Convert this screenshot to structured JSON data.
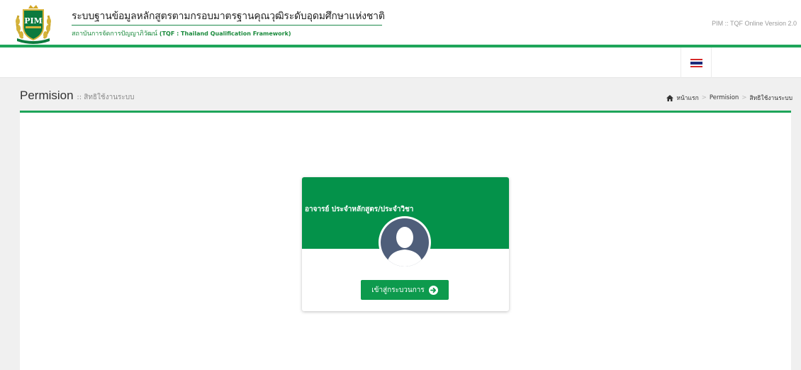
{
  "header": {
    "logo_text": "PIM",
    "title": "ระบบฐานข้อมูลหลักสูตรตามกรอบมาตรฐานคุณวุฒิระดับอุดมศึกษาแห่งชาติ",
    "subtitle_th": "สถาบันการจัดการปัญญาภิวัฒน์",
    "subtitle_en": "(TQF : Thailand Qualification Framework)",
    "version": "PIM :: TQF Online Version 2.0"
  },
  "topnav": {
    "language_flag": "thai-flag-icon"
  },
  "page": {
    "title": "Permision",
    "subtitle": ":: สิทธิใช้งานระบบ"
  },
  "breadcrumb": {
    "home": "หน้าแรก",
    "items": [
      "Permision",
      "สิทธิใช้งานระบบ"
    ]
  },
  "card": {
    "title": "อาจารย์ ประจำหลักสูตร/ประจำวิชา",
    "button_label": "เข้าสู่กระบวนการ",
    "avatar_icon": "user-avatar-icon",
    "button_icon": "arrow-right-circle-icon"
  },
  "colors": {
    "brand_green": "#1ea55a",
    "card_header": "#04924a",
    "avatar_bg": "#4f5e7a"
  }
}
